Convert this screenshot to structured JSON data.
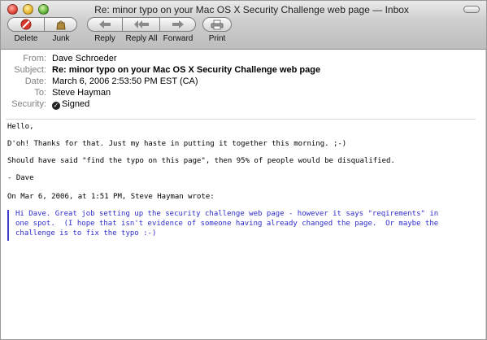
{
  "window": {
    "title": "Re: minor typo on your Mac OS X Security Challenge web page — Inbox"
  },
  "toolbar": {
    "delete_label": "Delete",
    "junk_label": "Junk",
    "reply_label": "Reply",
    "reply_all_label": "Reply All",
    "forward_label": "Forward",
    "print_label": "Print"
  },
  "headers": {
    "from_label": "From:",
    "from_value": "Dave Schroeder",
    "subject_label": "Subject:",
    "subject_value": "Re: minor typo on your Mac OS X Security Challenge web page",
    "date_label": "Date:",
    "date_value": "March 6, 2006 2:53:50 PM EST (CA)",
    "to_label": "To:",
    "to_value": "Steve Hayman",
    "security_label": "Security:",
    "security_value": "Signed"
  },
  "message": {
    "lines": [
      "Hello,",
      "D'oh! Thanks for that. Just my haste in putting it together this morning. ;-)",
      "Should have said \"find the typo on this page\", then 95% of people would be disqualified.",
      "- Dave",
      "On Mar 6, 2006, at 1:51 PM, Steve Hayman wrote:"
    ],
    "quoted": [
      "Hi Dave. Great job setting up the security challenge web page - however it says \"reqirements\" in",
      "one spot.  (I hope that isn't evidence of someone having already changed the page.  Or maybe the",
      "challenge is to fix the typo :-)"
    ]
  },
  "icons": {
    "delete": "no-entry-icon",
    "junk": "junk-bag-icon",
    "reply": "reply-arrow-icon",
    "reply_all": "reply-all-arrows-icon",
    "forward": "forward-arrow-icon",
    "print": "printer-icon",
    "signed": "seal-check-icon"
  },
  "colors": {
    "quote_text": "#2d2dc8",
    "quote_bar": "#3b3bd0",
    "header_label": "#7f7f7f",
    "delete_icon": "#d83a2c"
  }
}
